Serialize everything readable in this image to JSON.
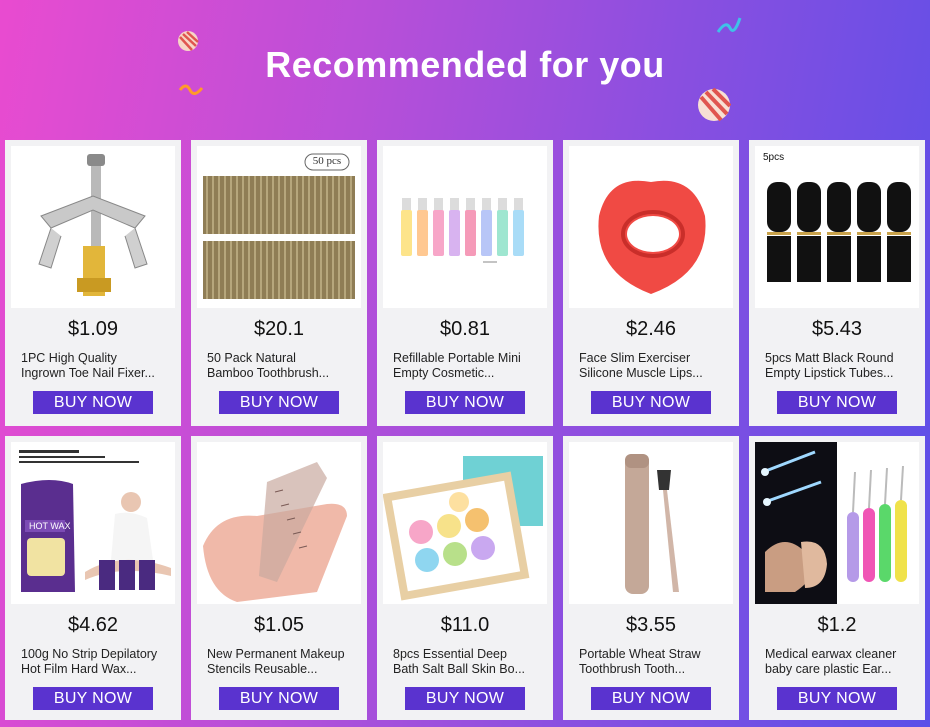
{
  "header": {
    "title": "Recommended for you"
  },
  "cta_label": "BUY NOW",
  "products": [
    {
      "icon": "nail-fixer-image",
      "price": "$1.09",
      "name_line1": "1PC High Quality",
      "name_line2": "Ingrown Toe Nail Fixer..."
    },
    {
      "icon": "toothbrush-pack-image",
      "price": "$20.1",
      "name_line1": "50 Pack Natural",
      "name_line2": "Bamboo Toothbrush...",
      "badge": "50 pcs"
    },
    {
      "icon": "cosmetic-bottles-image",
      "price": "$0.81",
      "name_line1": "Refillable Portable Mini",
      "name_line2": "Empty Cosmetic..."
    },
    {
      "icon": "lip-exerciser-image",
      "price": "$2.46",
      "name_line1": "Face Slim Exerciser",
      "name_line2": "Silicone Muscle Lips..."
    },
    {
      "icon": "lipstick-tubes-image",
      "price": "$5.43",
      "name_line1": "5pcs Matt Black Round",
      "name_line2": "Empty Lipstick Tubes...",
      "badge": "5pcs"
    },
    {
      "icon": "hot-wax-image",
      "price": "$4.62",
      "name_line1": "100g No Strip Depilatory",
      "name_line2": "Hot Film Hard Wax...",
      "badge": "HOT WAX"
    },
    {
      "icon": "makeup-stencil-image",
      "price": "$1.05",
      "name_line1": "New Permanent Makeup",
      "name_line2": "Stencils Reusable..."
    },
    {
      "icon": "bath-bombs-image",
      "price": "$11.0",
      "name_line1": "8pcs Essential Deep",
      "name_line2": "Bath Salt Ball Skin Bo..."
    },
    {
      "icon": "straw-toothbrush-image",
      "price": "$3.55",
      "name_line1": "Portable Wheat Straw",
      "name_line2": "Toothbrush Tooth..."
    },
    {
      "icon": "earwax-cleaner-image",
      "price": "$1.2",
      "name_line1": "Medical earwax cleaner",
      "name_line2": "baby care plastic Ear..."
    }
  ],
  "colors": {
    "button": "#5a33cf",
    "card": "#f2f2f4"
  }
}
